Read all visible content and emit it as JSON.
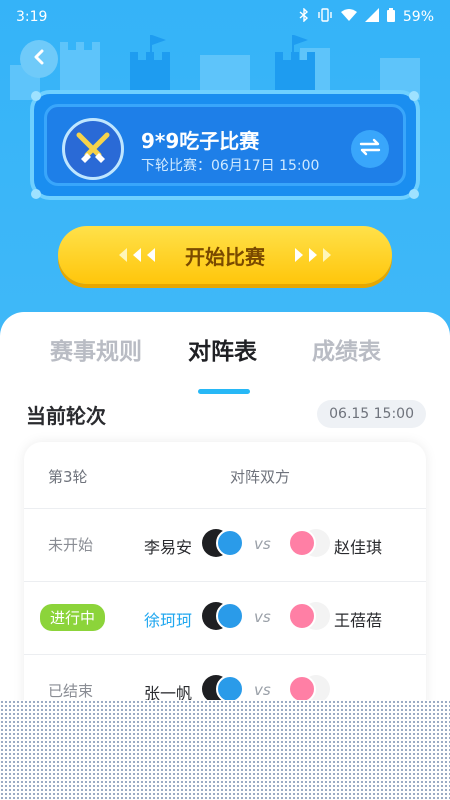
{
  "status_bar": {
    "time": "3:19",
    "battery": "59%"
  },
  "header": {
    "match_title": "9*9吃子比赛",
    "next_round_label": "下轮比赛：",
    "next_round_time": "06月17日 15:00",
    "start_button": "开始比赛"
  },
  "tabs": [
    {
      "label": "赛事规则",
      "active": false
    },
    {
      "label": "对阵表",
      "active": true
    },
    {
      "label": "成绩表",
      "active": false
    }
  ],
  "current_round": {
    "title": "当前轮次",
    "time": "06.15 15:00"
  },
  "table": {
    "round_label": "第3轮",
    "opponents_label": "对阵双方",
    "rows": [
      {
        "status": "未开始",
        "left": "李易安",
        "vs": "vs",
        "right": "赵佳琪"
      },
      {
        "status": "进行中",
        "left": "徐珂珂",
        "vs": "vs",
        "right": "王蓓蓓"
      },
      {
        "status": "已结束",
        "left": "张一帆",
        "vs": "vs",
        "right": ""
      }
    ]
  },
  "colors": {
    "sky": "#35b3f8",
    "accent": "#27b8f6",
    "gold": "#ffc60b",
    "live": "#8cd43a"
  },
  "icons": [
    "back-arrow-icon",
    "crossed-swords-icon",
    "swap-icon",
    "bluetooth-icon",
    "vibrate-icon",
    "wifi-icon",
    "signal-icon",
    "battery-icon"
  ]
}
